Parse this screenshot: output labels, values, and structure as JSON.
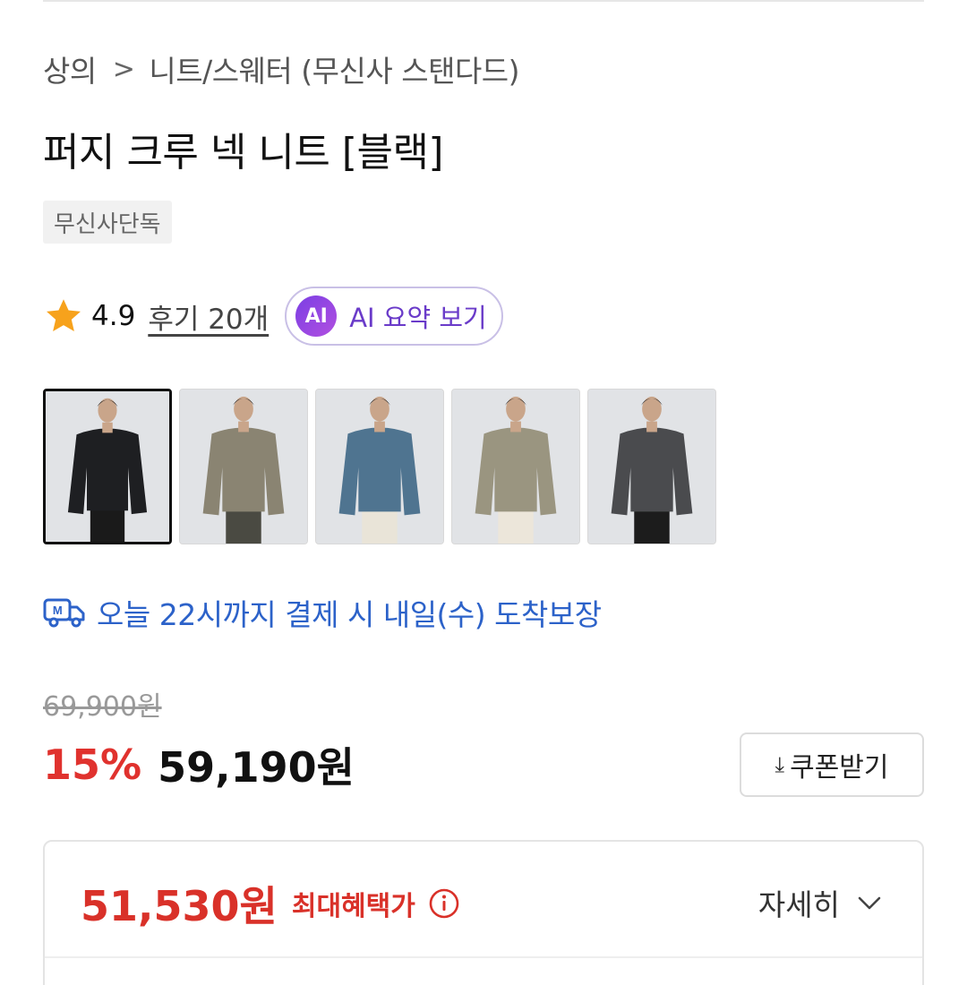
{
  "breadcrumb": {
    "category": "상의",
    "separator": ">",
    "subcategory": "니트/스웨터 (무신사 스탠다드)"
  },
  "product": {
    "title": "퍼지 크루 넥 니트 [블랙]",
    "badge": "무신사단독"
  },
  "rating": {
    "score": "4.9",
    "reviews": "후기 20개",
    "ai_badge": "AI",
    "ai_summary": "AI 요약 보기"
  },
  "thumbnails": [
    {
      "color": "#1e1f22",
      "pants": "#1a1a1a",
      "selected": true
    },
    {
      "color": "#8a8472",
      "pants": "#4a4a42",
      "selected": false
    },
    {
      "color": "#4f7490",
      "pants": "#e9e4d8",
      "selected": false
    },
    {
      "color": "#9a9580",
      "pants": "#ece6da",
      "selected": false
    },
    {
      "color": "#4a4b4e",
      "pants": "#1c1c1c",
      "selected": false
    }
  ],
  "delivery": {
    "text": "오늘 22시까지 결제 시 내일(수) 도착보장",
    "color": "#2c62c9"
  },
  "pricing": {
    "original": "69,900원",
    "discount": "15%",
    "sale": "59,190원",
    "coupon_button": "쿠폰받기",
    "max_benefit_price": "51,530원",
    "max_benefit_label": "최대혜택가",
    "detail_button": "자세히",
    "accent_color": "#e0322e"
  }
}
